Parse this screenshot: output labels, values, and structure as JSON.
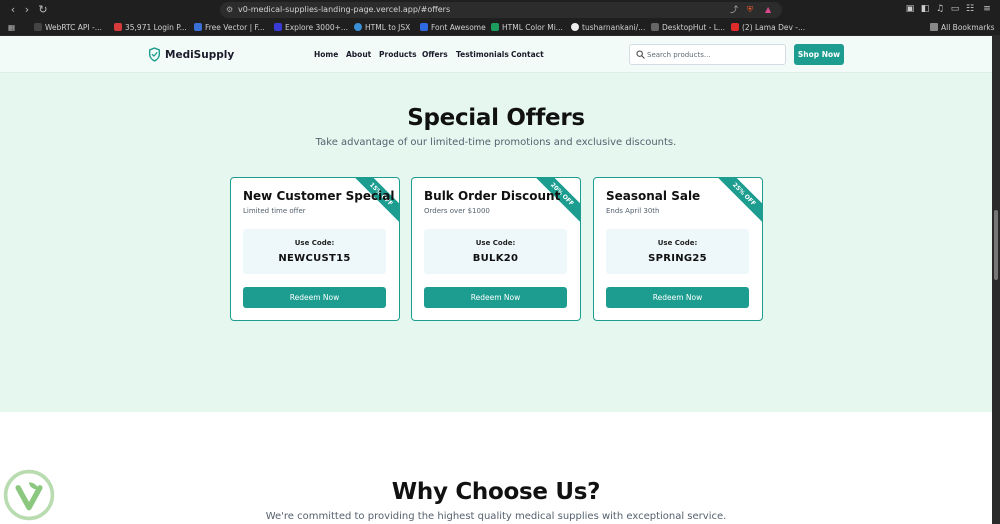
{
  "browser": {
    "url": "v0-medical-supplies-landing-page.vercel.app/#offers",
    "bookmarks": [
      {
        "label": "WebRTC API -...",
        "color": "#444444"
      },
      {
        "label": "35,971 Login P...",
        "color": "#d63a3a"
      },
      {
        "label": "Free Vector | F...",
        "color": "#3a6fd6"
      },
      {
        "label": "Explore 3000+...",
        "color": "#3a3ad6"
      },
      {
        "label": "HTML to JSX",
        "color": "#3a8fd6"
      },
      {
        "label": "Font Awesome",
        "color": "#2f6be0"
      },
      {
        "label": "HTML Color Mi...",
        "color": "#1c9d5f"
      },
      {
        "label": "tusharnankani/...",
        "color": "#eeeeee"
      },
      {
        "label": "DesktopHut - L...",
        "color": "#666666"
      },
      {
        "label": "(2) Lama Dev -...",
        "color": "#e02b2b"
      }
    ],
    "all_bookmarks": "All Bookmarks"
  },
  "site": {
    "brand": "MediSupply",
    "nav": [
      "Home",
      "About",
      "Products",
      "Offers",
      "Testimonials",
      "Contact"
    ],
    "search_placeholder": "Search products...",
    "shop_button": "Shop Now"
  },
  "offers": {
    "title": "Special Offers",
    "subtitle": "Take advantage of our limited-time promotions and exclusive discounts.",
    "code_label": "Use Code:",
    "redeem_label": "Redeem Now",
    "cards": [
      {
        "title": "New Customer Special",
        "sub": "Limited time offer",
        "ribbon": "15% OFF",
        "code": "NEWCUST15"
      },
      {
        "title": "Bulk Order Discount",
        "sub": "Orders over $1000",
        "ribbon": "20% OFF",
        "code": "BULK20"
      },
      {
        "title": "Seasonal Sale",
        "sub": "Ends April 30th",
        "ribbon": "25% OFF",
        "code": "SPRING25"
      }
    ]
  },
  "why": {
    "title": "Why Choose Us?",
    "subtitle": "We're committed to providing the highest quality medical supplies with exceptional service."
  },
  "colors": {
    "accent": "#1c9d8f",
    "offers_bg": "#e6f7f0",
    "header_bg": "#f3fbf8"
  }
}
